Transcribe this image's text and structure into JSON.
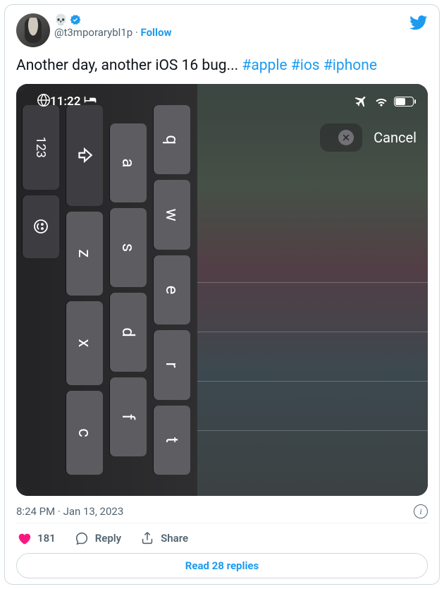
{
  "author": {
    "display_name_emoji": "💀",
    "handle": "@t3mporarybl1p",
    "follow_label": "Follow"
  },
  "tweet": {
    "text_plain": "Another day, another iOS 16 bug... ",
    "hashtags": [
      "#apple",
      "#ios",
      "#iphone"
    ]
  },
  "media": {
    "status_time": "11:22",
    "cancel_label": "Cancel",
    "keyboard": {
      "row1": [
        "q",
        "w",
        "e",
        "r",
        "t"
      ],
      "row2": [
        "a",
        "s",
        "d",
        "f"
      ],
      "row3": [
        "z",
        "x",
        "c"
      ],
      "num_key": "123"
    }
  },
  "meta": {
    "timestamp": "8:24 PM · Jan 13, 2023",
    "like_count": "181",
    "reply_label": "Reply",
    "share_label": "Share",
    "read_replies": "Read 28 replies"
  }
}
